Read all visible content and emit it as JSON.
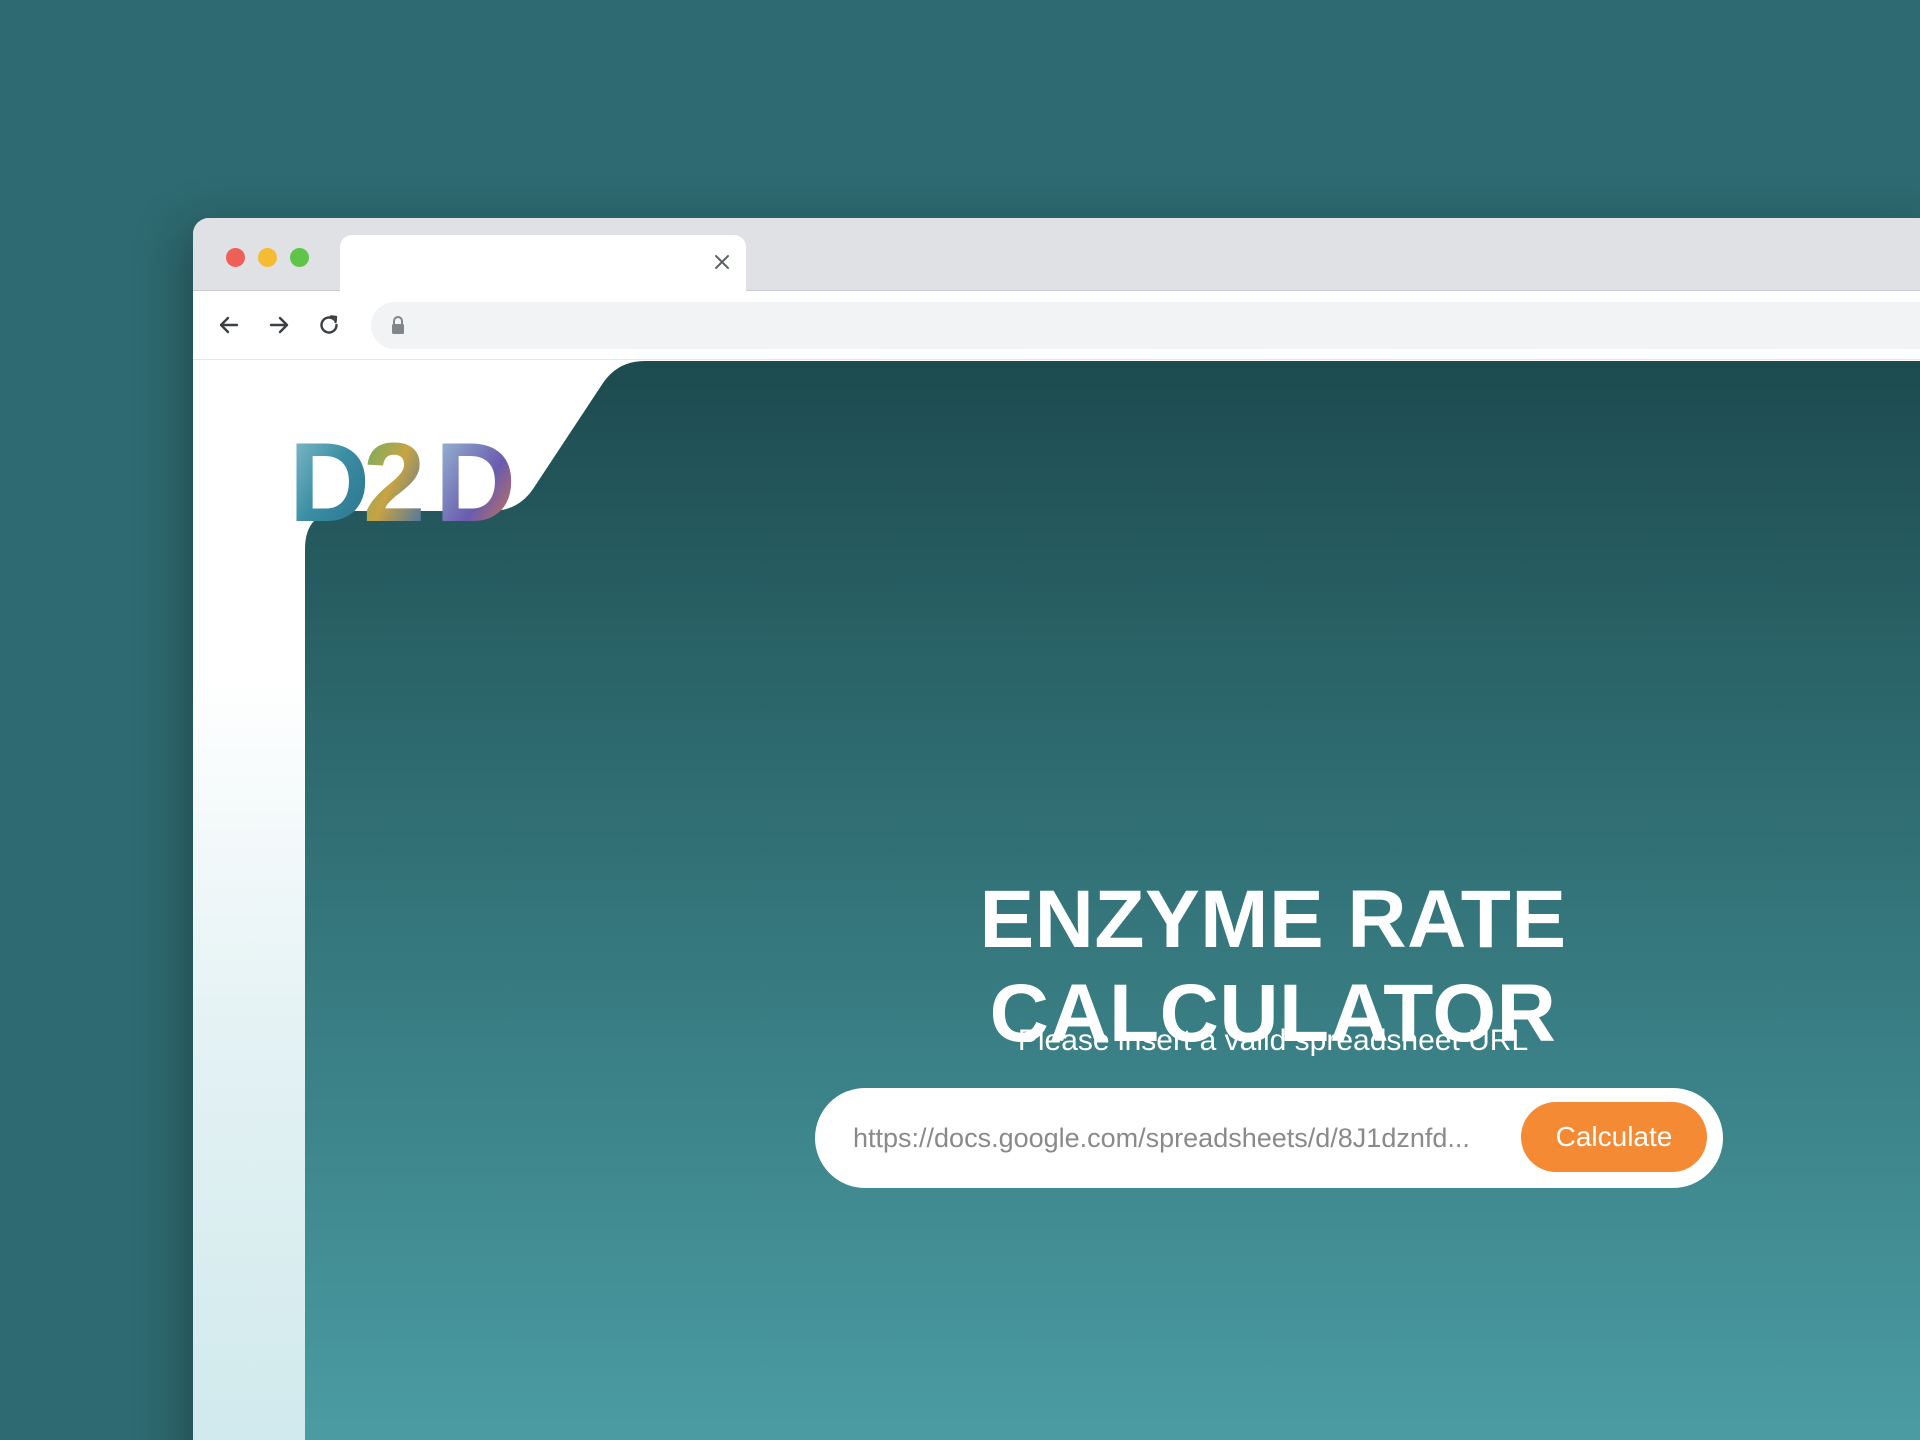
{
  "browser": {
    "tab_title": "",
    "address_url": ""
  },
  "logo": {
    "text": "D2D"
  },
  "hero": {
    "title": "ENZYME RATE CALCULATOR",
    "subtitle": "Please insert a valid spreadsheet URL",
    "url_value": "https://docs.google.com/spreadsheets/d/8J1dznfd...",
    "button_label": "Calculate"
  },
  "colors": {
    "background": "#2e6a71",
    "hero_top": "#1d4b4f",
    "hero_bottom": "#4c9fa6",
    "button": "#f58a35"
  }
}
